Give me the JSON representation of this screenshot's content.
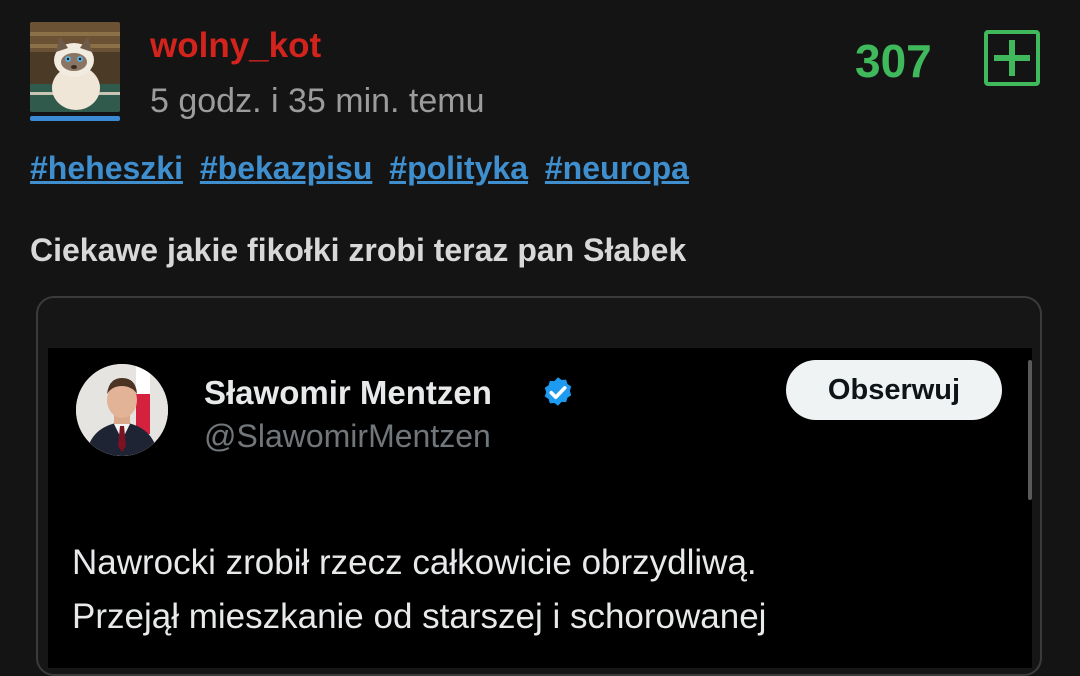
{
  "post": {
    "username": "wolny_kot",
    "timestamp": "5 godz. i 35 min. temu",
    "score": "307",
    "tags": [
      "#heheszki",
      "#bekazpisu",
      "#polityka",
      "#neuropa"
    ],
    "body": "Ciekawe jakie fikołki zrobi teraz pan Słabek"
  },
  "embed": {
    "name": "Sławomir Mentzen",
    "handle": "@SlawomirMentzen",
    "follow_label": "Obserwuj",
    "text_lines": [
      "Nawrocki zrobił rzecz całkowicie obrzydliwą.",
      "Przejął mieszkanie od starszej i schorowanej"
    ]
  },
  "colors": {
    "username": "#d2231d",
    "score": "#3fb95c",
    "tag": "#3f8fcf",
    "verified": "#1d9bf0"
  },
  "icons": {
    "upvote": "plus-square-icon",
    "verified": "verified-badge-icon"
  }
}
